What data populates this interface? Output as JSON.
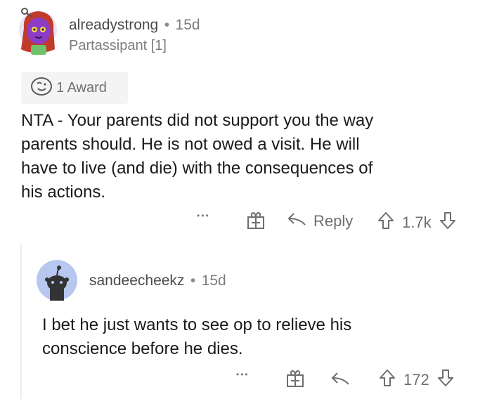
{
  "comment": {
    "author": "alreadystrong",
    "separator": "•",
    "age": "15d",
    "flair": "Partassipant [1]",
    "award_label": "1 Award",
    "text_lines": [
      "NTA - Your parents did not support you the way",
      "parents should. He is not owed a visit. He will",
      "have to live (and die) with the consequences of",
      "his actions."
    ],
    "more_label": "•••",
    "reply_label": "Reply",
    "score": "1.7k"
  },
  "reply": {
    "author": "sandeecheekz",
    "separator": "•",
    "age": "15d",
    "text_lines": [
      "I bet he just wants to see op to relieve his",
      "conscience before he dies."
    ],
    "more_label": "•••",
    "score": "172"
  },
  "colors": {
    "text": "#1a1a1b",
    "muted": "#7c7c7c",
    "award_bg": "#f4f4f5",
    "avatar_bg": "#b7c7f0",
    "avatar_hair": "#c23a2a",
    "avatar_face": "#8e3cc8"
  },
  "icons": [
    "award-icon",
    "gift-icon",
    "reply-arrow-icon",
    "upvote-icon",
    "downvote-icon"
  ]
}
